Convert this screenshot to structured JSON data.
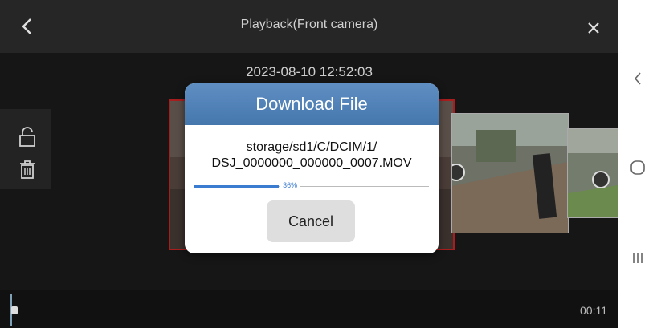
{
  "header": {
    "title": "Playback(Front camera)",
    "back_icon": "chevron-left-icon",
    "close_icon": "close-icon"
  },
  "recording": {
    "timestamp": "2023-08-10 12:52:03"
  },
  "side_tools": [
    {
      "icon": "unlock-icon"
    },
    {
      "icon": "trash-icon"
    }
  ],
  "timeline": {
    "end_time": "00:11"
  },
  "dialog": {
    "title": "Download File",
    "file_path_line1": "storage/sd1/C/DCIM/1/",
    "file_path_line2": "DSJ_0000000_000000_0007.MOV",
    "progress_percent": 36,
    "progress_label": "36%",
    "cancel_label": "Cancel"
  },
  "colors": {
    "dialog_header": "#4f82b8",
    "progress": "#3b7bd0",
    "selected_border": "#a81e1e"
  }
}
